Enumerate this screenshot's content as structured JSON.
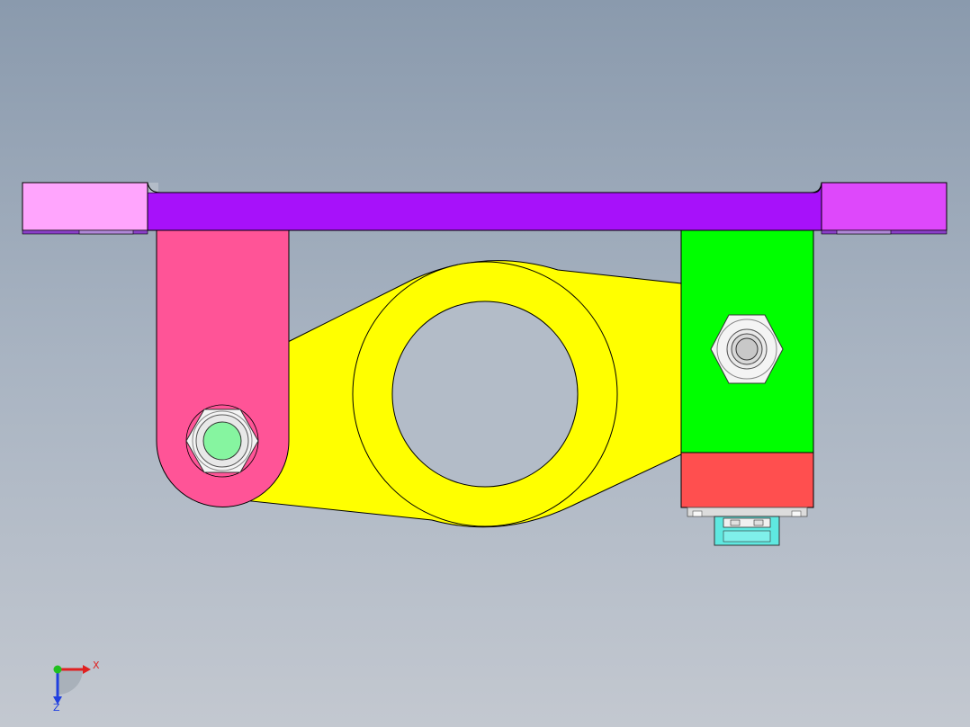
{
  "viewport": {
    "background_top": "#8a9aad",
    "background_bottom": "#c3c8d0"
  },
  "model": {
    "parts": [
      {
        "name": "mounting-plate",
        "color": "#a711fa"
      },
      {
        "name": "plate-end-left",
        "color": "#ffa5fd"
      },
      {
        "name": "plate-end-right",
        "color": "#de48fb"
      },
      {
        "name": "link-arm",
        "color": "#ff5497"
      },
      {
        "name": "bracket-body",
        "color": "#ffff00"
      },
      {
        "name": "clamp-block",
        "color": "#00ff00"
      },
      {
        "name": "clamp-base",
        "color": "#ff4f4f"
      },
      {
        "name": "pin-head",
        "color": "#86f5a0"
      },
      {
        "name": "connector",
        "color": "#5fe8e0"
      }
    ]
  },
  "triad": {
    "x_label": "X",
    "z_label": "Z",
    "x_color": "#e02020",
    "y_color": "#20c020",
    "z_color": "#2040e0"
  }
}
